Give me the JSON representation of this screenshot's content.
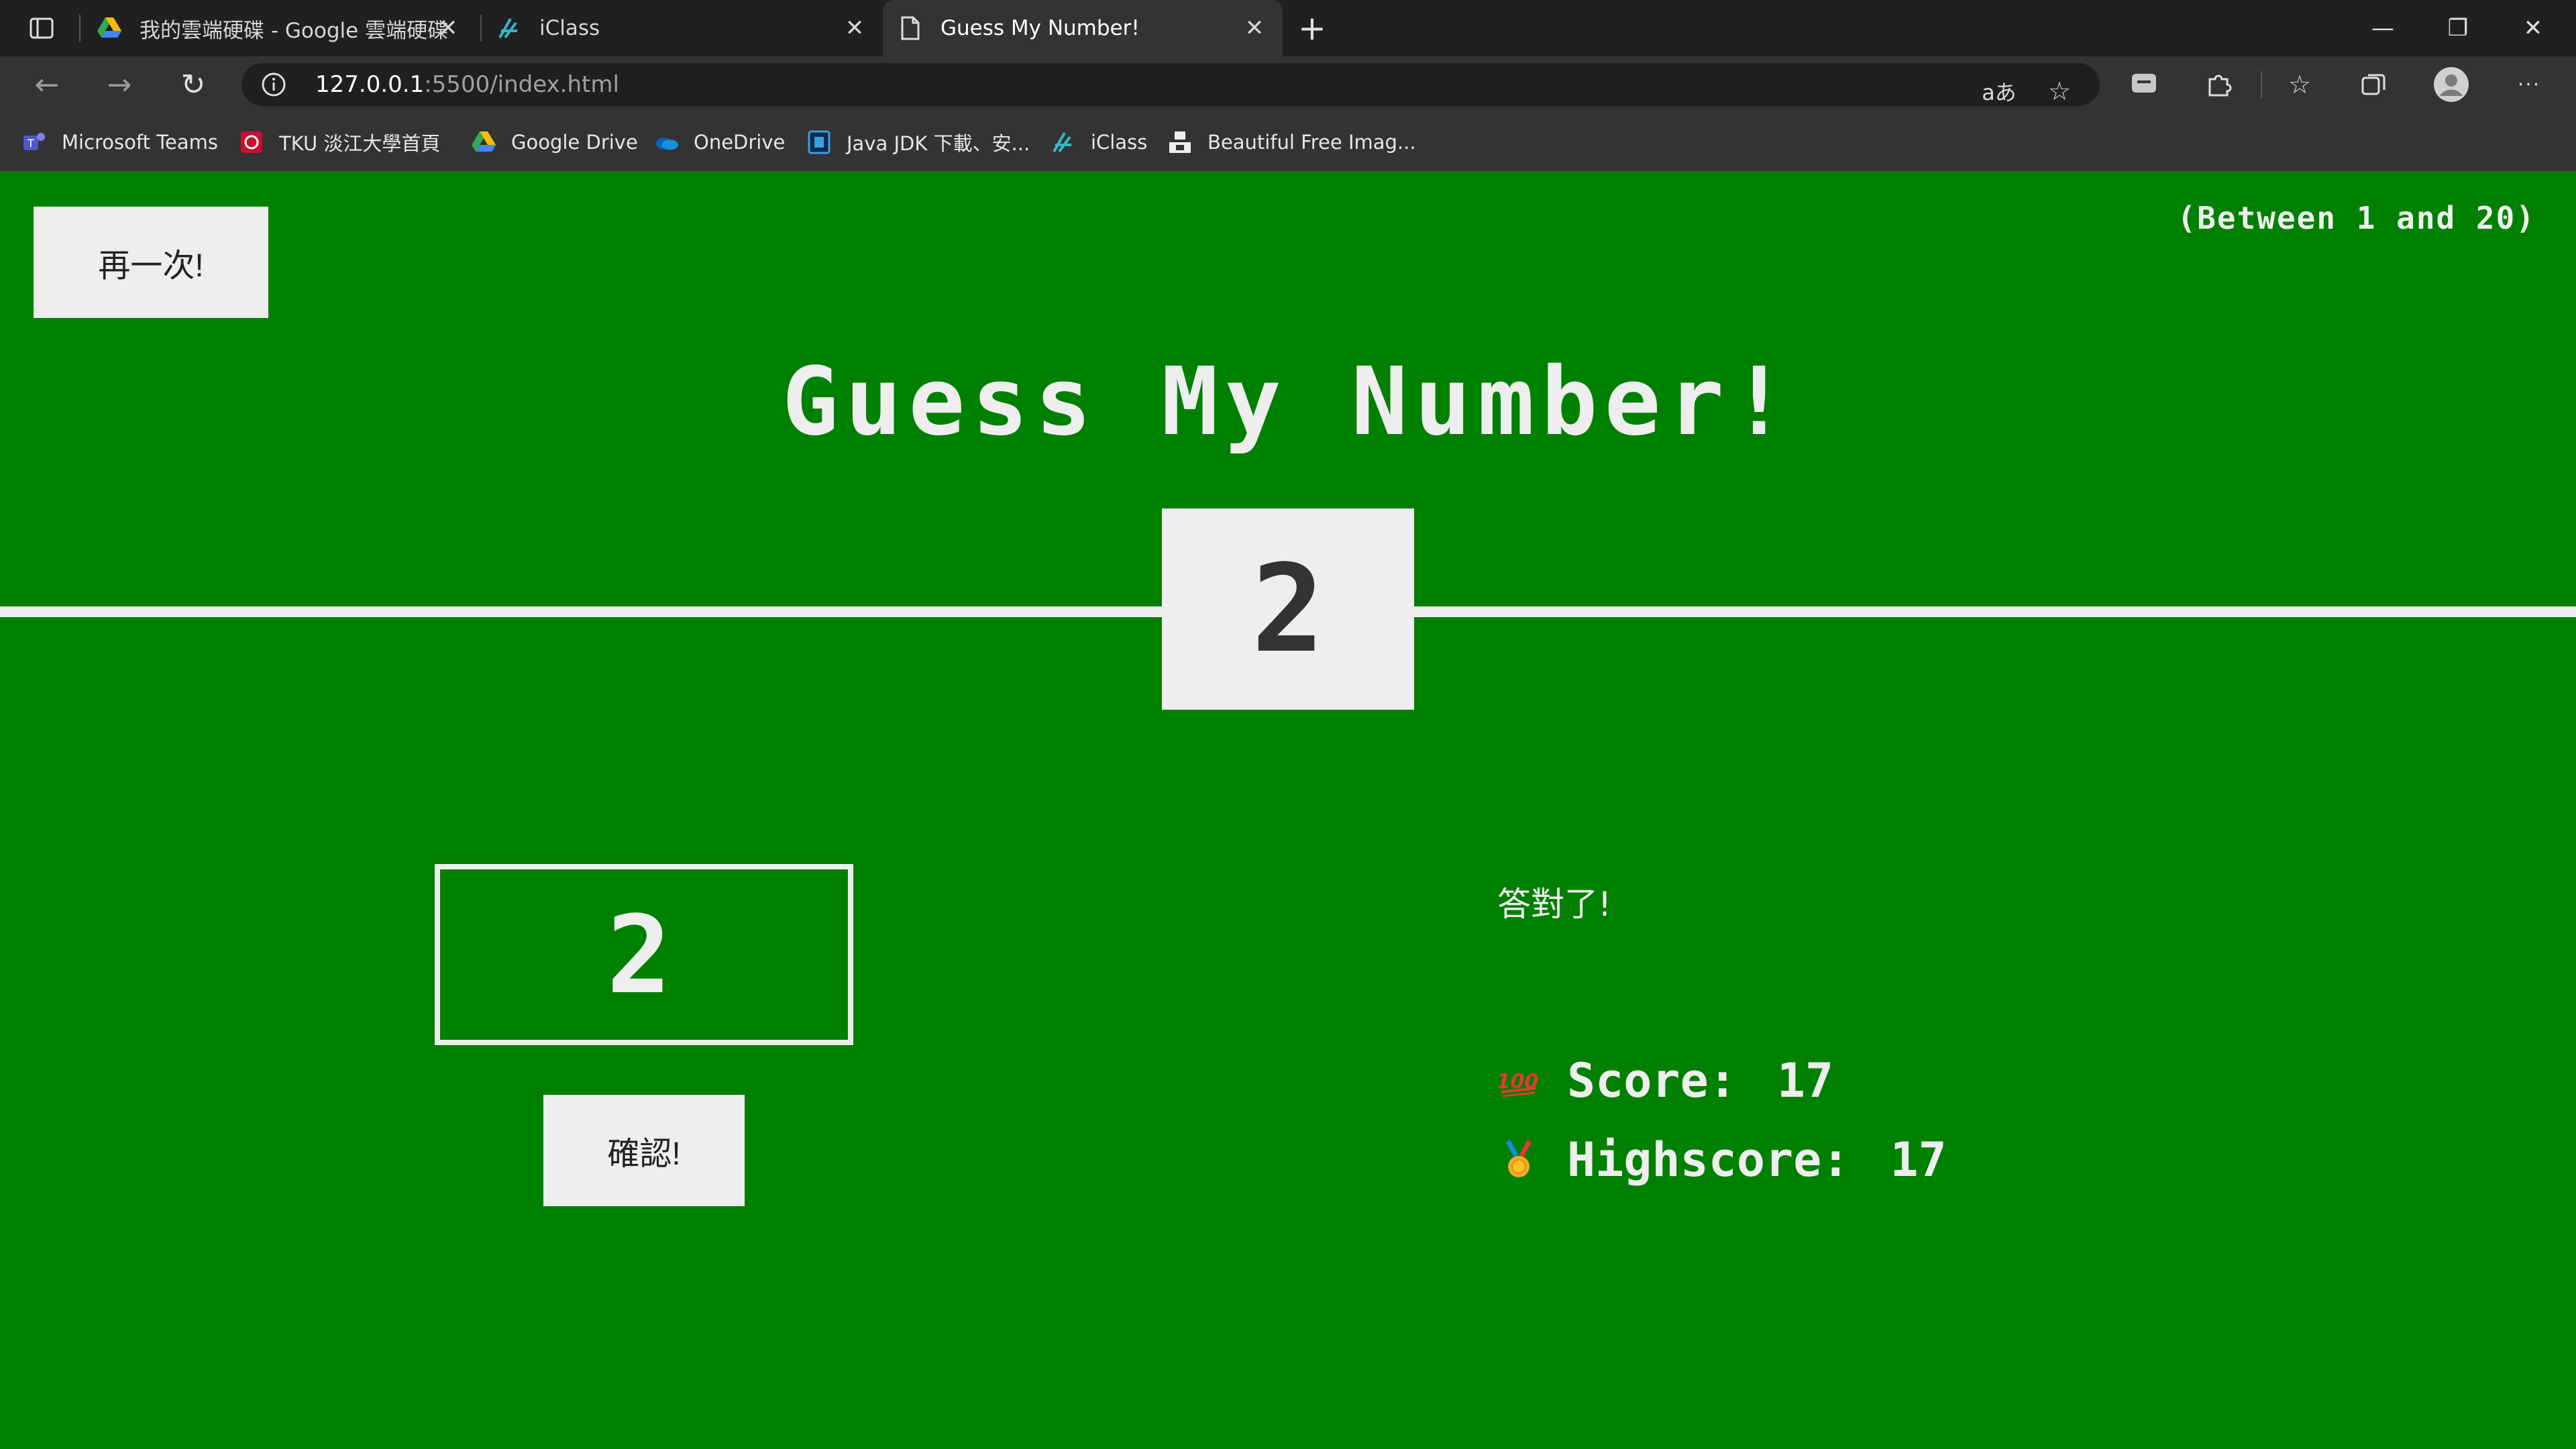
{
  "browser": {
    "tabs": [
      {
        "title": "我的雲端硬碟 - Google 雲端硬碟",
        "icon": "google-drive-icon"
      },
      {
        "title": "iClass",
        "icon": "iclass-icon"
      },
      {
        "title": "Guess My Number!",
        "icon": "page-icon"
      }
    ],
    "new_tab_symbol": "+",
    "close_symbol": "✕",
    "url_host": "127.0.0.1",
    "url_path": ":5500/index.html",
    "bookmarks": [
      {
        "label": "Microsoft Teams",
        "icon": "teams-icon"
      },
      {
        "label": "TKU 淡江大學首頁",
        "icon": "tku-icon"
      },
      {
        "label": "Google Drive",
        "icon": "google-drive-icon"
      },
      {
        "label": "OneDrive",
        "icon": "onedrive-icon"
      },
      {
        "label": "Java JDK 下載、安...",
        "icon": "java-icon"
      },
      {
        "label": "iClass",
        "icon": "iclass-icon"
      },
      {
        "label": "Beautiful Free Imag...",
        "icon": "unsplash-icon"
      }
    ],
    "toolbar_glyphs": {
      "back": "←",
      "forward": "→",
      "reload": "↻",
      "read_aloud": "aあ",
      "favorite_add": "☆",
      "favorites": "☆",
      "more": "···",
      "minimize": "—",
      "restore": "❐",
      "close": "✕"
    }
  },
  "game": {
    "again_label": "再一次!",
    "between_text": "(Between 1 and 20)",
    "title": "Guess My Number!",
    "secret_number": "2",
    "guess_value": "2",
    "check_label": "確認!",
    "message": "答對了!",
    "score_label": "Score:",
    "score_value": "17",
    "highscore_label": "Highscore:",
    "highscore_value": "17",
    "score_icon": "hundred-points-icon",
    "highscore_icon": "medal-icon"
  },
  "colors": {
    "background": "#008000",
    "foreground": "#eeeeee",
    "number_text": "#333333"
  }
}
